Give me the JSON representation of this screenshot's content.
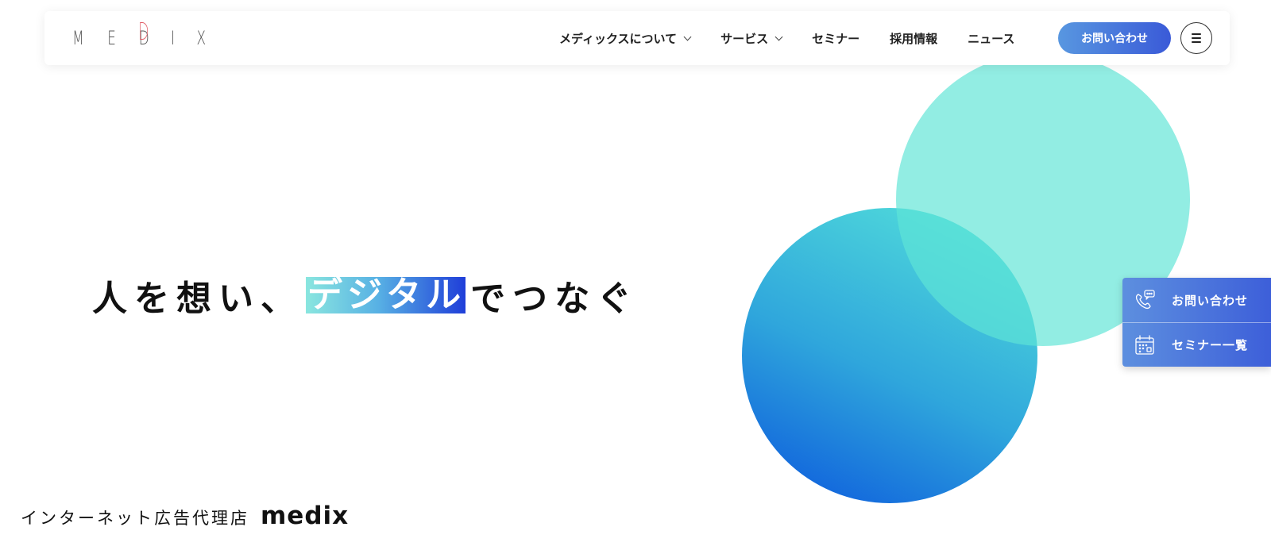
{
  "header": {
    "logo_letters": [
      "M",
      "E",
      "D",
      "I",
      "X"
    ],
    "nav": [
      {
        "label": "メディックスについて",
        "has_dropdown": true
      },
      {
        "label": "サービス",
        "has_dropdown": true
      },
      {
        "label": "セミナー",
        "has_dropdown": false
      },
      {
        "label": "採用情報",
        "has_dropdown": false
      },
      {
        "label": "ニュース",
        "has_dropdown": false
      }
    ],
    "contact_button": "お問い合わせ",
    "menu_icon": "hamburger-menu-icon"
  },
  "hero": {
    "text_before": "人を想い、",
    "text_highlight": "デジタル",
    "text_after": "でつなぐ"
  },
  "tagline": {
    "text": "インターネット広告代理店",
    "brand": "medix"
  },
  "side_widget": {
    "contact": {
      "label": "お問い合わせ",
      "icon": "phone-chat-icon"
    },
    "seminars": {
      "label": "セミナー一覧",
      "icon": "calendar-icon"
    }
  },
  "colors": {
    "accent_gradient_start": "#5897e0",
    "accent_gradient_end": "#3a5ad8",
    "circle_teal": "#5fe4d6",
    "circle_blue": "#0a55dd",
    "logo_highlight": "#e05a64"
  }
}
